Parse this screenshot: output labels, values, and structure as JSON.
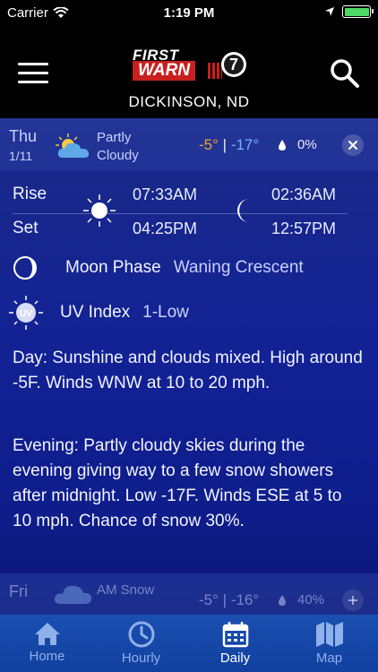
{
  "status": {
    "carrier": "Carrier",
    "time": "1:19 PM"
  },
  "header": {
    "logo_first": "FIRST",
    "logo_warn": "WARN",
    "logo_channel": "7",
    "location": "DICKINSON, ND"
  },
  "day": {
    "name": "Thu",
    "date": "1/11",
    "condition_line1": "Partly",
    "condition_line2": "Cloudy",
    "hi": "-5°",
    "sep": "|",
    "lo": "-17°",
    "precip": "0%"
  },
  "sun": {
    "rise_label": "Rise",
    "set_label": "Set",
    "sunrise": "07:33AM",
    "sunset": "04:25PM",
    "moonrise": "02:36AM",
    "moonset": "12:57PM"
  },
  "moon": {
    "label": "Moon Phase",
    "value": "Waning Crescent"
  },
  "uv": {
    "badge": "UV",
    "label": "UV Index",
    "value": "1-Low"
  },
  "forecast": {
    "day": "Day: Sunshine and clouds mixed. High around -5F. Winds WNW at 10 to 20 mph.",
    "evening": "Evening: Partly cloudy skies during the evening giving way to a few snow showers after midnight. Low -17F. Winds ESE at 5 to 10 mph. Chance of snow 30%."
  },
  "next": {
    "name": "Fri",
    "condition": "AM Snow",
    "hi": "-5°",
    "sep": "|",
    "lo": "-16°",
    "precip": "40%"
  },
  "tabs": [
    {
      "label": "Home"
    },
    {
      "label": "Hourly"
    },
    {
      "label": "Daily"
    },
    {
      "label": "Map"
    }
  ],
  "colors": {
    "hi": "#f0a030",
    "lo": "#6fb4ff",
    "tabbar": "#1a4fb0",
    "background": "#122295"
  }
}
